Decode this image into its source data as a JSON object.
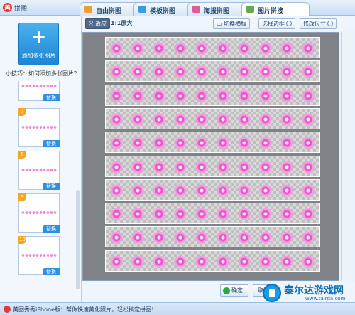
{
  "window": {
    "title": "拼图",
    "app_icon": "app-logo-icon"
  },
  "tabs": [
    {
      "label": "自由拼图",
      "active": false,
      "icon": "free-puzzle-icon",
      "color": "#e8a22c"
    },
    {
      "label": "模板拼图",
      "active": false,
      "icon": "template-puzzle-icon",
      "color": "#3a9be0"
    },
    {
      "label": "海报拼图",
      "active": false,
      "icon": "poster-puzzle-icon",
      "color": "#e05a9a"
    },
    {
      "label": "图片拼接",
      "active": true,
      "icon": "image-stitch-icon",
      "color": "#6aa84f"
    }
  ],
  "sidebar": {
    "add_button_label": "添加多张图片",
    "tip": "小技巧：如何添加多张图片？",
    "thumbnails": [
      {
        "number": "",
        "replace_label": "替换"
      },
      {
        "number": "7",
        "replace_label": "替换"
      },
      {
        "number": "8",
        "replace_label": "替换"
      },
      {
        "number": "9",
        "replace_label": "替换"
      },
      {
        "number": "10",
        "replace_label": "替换"
      }
    ]
  },
  "toolbar": {
    "fit_label": "适应",
    "original_label": "1:1原大",
    "switch_orientation_label": "切换横版",
    "choose_border_label": "选择边框",
    "resize_label": "修改尺寸"
  },
  "canvas": {
    "strip_count": 10
  },
  "actions": {
    "confirm_label": "确定",
    "cancel_label": "取消"
  },
  "statusbar": {
    "text": "美图秀秀iPhone版：帮你快速美化照片，轻松搞定拼图！"
  },
  "watermark": {
    "title": "泰尔达游戏网",
    "url": "www.tairda.com"
  },
  "colors": {
    "accent": "#1b86d6",
    "flower": "#e35ac8"
  }
}
